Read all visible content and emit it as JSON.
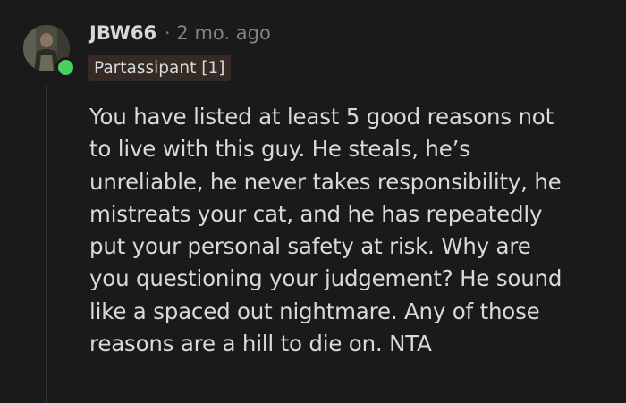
{
  "comment": {
    "username": "JBW66",
    "separator": "·",
    "timestamp": "2 mo. ago",
    "flair": "Partassipant [1]",
    "online_status_color": "#46d160",
    "body_lines": [
      "You have listed at least 5 good reasons not",
      "to live with this guy. He steals, he’s",
      "unreliable, he never takes responsibility, he",
      "mistreats your cat, and he has repeatedly",
      "put your personal safety at risk. Why are",
      "you questioning your judgement? He sound",
      "like a spaced out nightmare. Any of those",
      "reasons are a hill to die on. NTA"
    ]
  },
  "colors": {
    "background": "#1a1a1b",
    "text": "#d7dadc",
    "muted": "#818384",
    "flair_background": "#362a24"
  }
}
